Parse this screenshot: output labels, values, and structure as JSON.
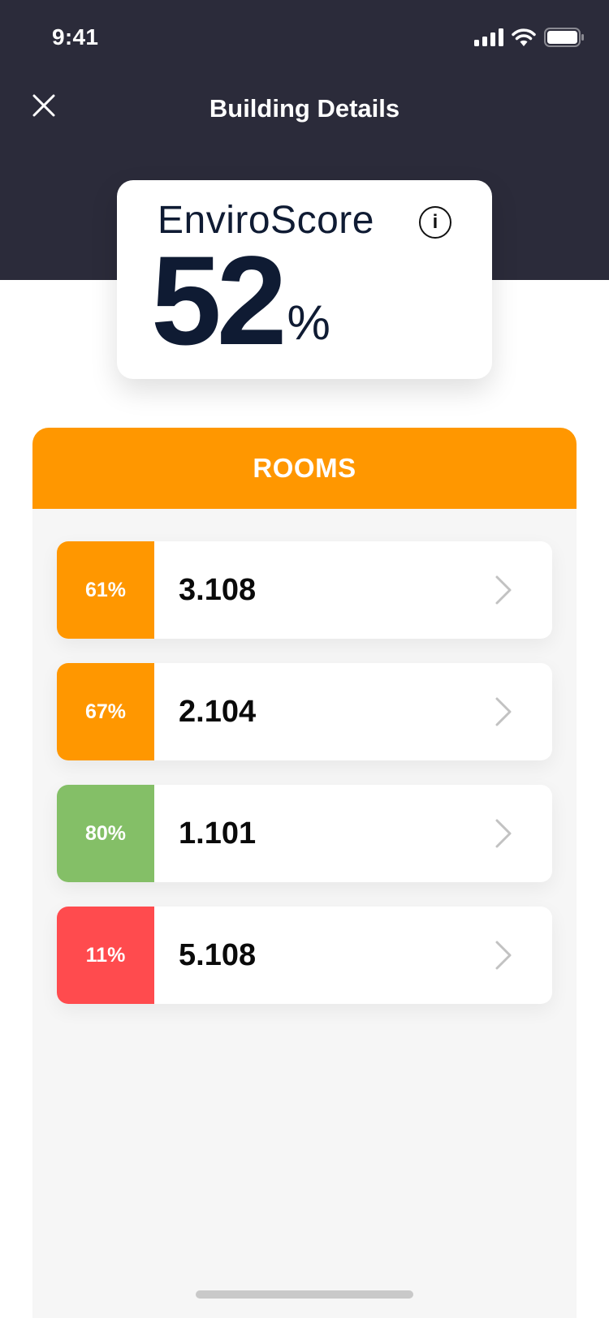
{
  "status_bar": {
    "time": "9:41",
    "signal_icon": "signal-icon",
    "wifi_icon": "wifi-icon",
    "battery_icon": "battery-icon"
  },
  "nav": {
    "title": "Building Details",
    "close_icon": "close-icon"
  },
  "score": {
    "label": "EnviroScore",
    "value": "52",
    "unit": "%",
    "info_glyph": "i",
    "info_icon": "info-icon"
  },
  "rooms": {
    "header": "ROOMS",
    "items": [
      {
        "percent": "61%",
        "name": "3.108",
        "color": "#ff9700"
      },
      {
        "percent": "67%",
        "name": "2.104",
        "color": "#ff9700"
      },
      {
        "percent": "80%",
        "name": "1.101",
        "color": "#84bf67"
      },
      {
        "percent": "11%",
        "name": "5.108",
        "color": "#ff4b4e"
      }
    ],
    "chevron_icon": "chevron-right-icon"
  },
  "colors": {
    "header_bg": "#2b2b3a",
    "accent_orange": "#ff9700",
    "good_green": "#84bf67",
    "bad_red": "#ff4b4e",
    "score_text": "#0f1b33"
  }
}
